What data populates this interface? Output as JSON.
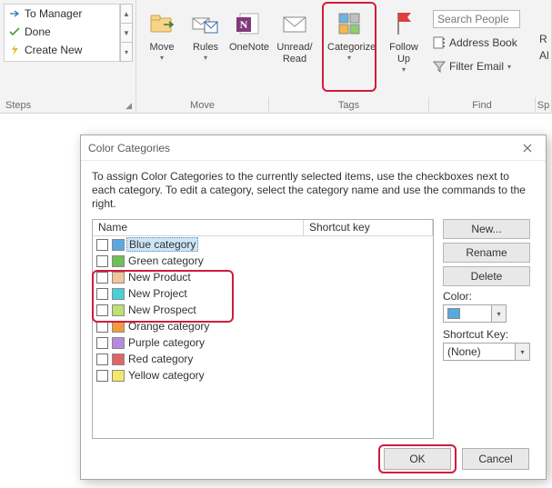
{
  "ribbon": {
    "steps": {
      "items": [
        {
          "label": "To Manager"
        },
        {
          "label": "Done"
        },
        {
          "label": "Create New"
        }
      ],
      "group_label": "Steps"
    },
    "move": {
      "move_label": "Move",
      "rules_label": "Rules",
      "onenote_label": "OneNote",
      "group_label": "Move"
    },
    "tags": {
      "unread_label_l1": "Unread/",
      "unread_label_l2": "Read",
      "categorize_label": "Categorize",
      "followup_label_l1": "Follow",
      "followup_label_l2": "Up",
      "group_label": "Tags"
    },
    "find": {
      "search_placeholder": "Search People",
      "address_label": "Address Book",
      "filter_label": "Filter Email",
      "group_label": "Find"
    },
    "sp": {
      "line1": "R",
      "line2": "Al",
      "group_label": "Sp"
    }
  },
  "dialog": {
    "title": "Color Categories",
    "instruction": "To assign Color Categories to the currently selected items, use the checkboxes next to each category.  To edit a category, select the category name and use the commands to the right.",
    "headers": {
      "name": "Name",
      "shortcut": "Shortcut key"
    },
    "categories": [
      {
        "label": "Blue category",
        "cls": "c-blue",
        "hl": true
      },
      {
        "label": "Green category",
        "cls": "c-green",
        "hl": false
      },
      {
        "label": "New Product",
        "cls": "c-peach",
        "hl": false
      },
      {
        "label": "New Project",
        "cls": "c-teal",
        "hl": false
      },
      {
        "label": "New Prospect",
        "cls": "c-lime",
        "hl": false
      },
      {
        "label": "Orange category",
        "cls": "c-orange",
        "hl": false
      },
      {
        "label": "Purple category",
        "cls": "c-purple",
        "hl": false
      },
      {
        "label": "Red category",
        "cls": "c-red",
        "hl": false
      },
      {
        "label": "Yellow category",
        "cls": "c-yellow",
        "hl": false
      }
    ],
    "buttons": {
      "new": "New...",
      "rename": "Rename",
      "delete": "Delete",
      "ok": "OK",
      "cancel": "Cancel"
    },
    "color_label": "Color:",
    "shortcut_label": "Shortcut Key:",
    "shortcut_value": "(None)"
  }
}
